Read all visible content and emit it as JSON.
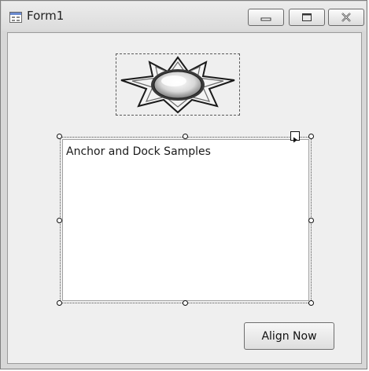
{
  "window": {
    "title": "Form1",
    "icons": {
      "app": "form-icon",
      "minimize": "minimize-icon",
      "maximize": "maximize-icon",
      "close": "close-icon"
    }
  },
  "form": {
    "picture_box": {
      "icon": "star-shape-icon"
    },
    "textbox": {
      "text": "Anchor and Dock Samples"
    },
    "align_button": {
      "label": "Align Now"
    }
  }
}
